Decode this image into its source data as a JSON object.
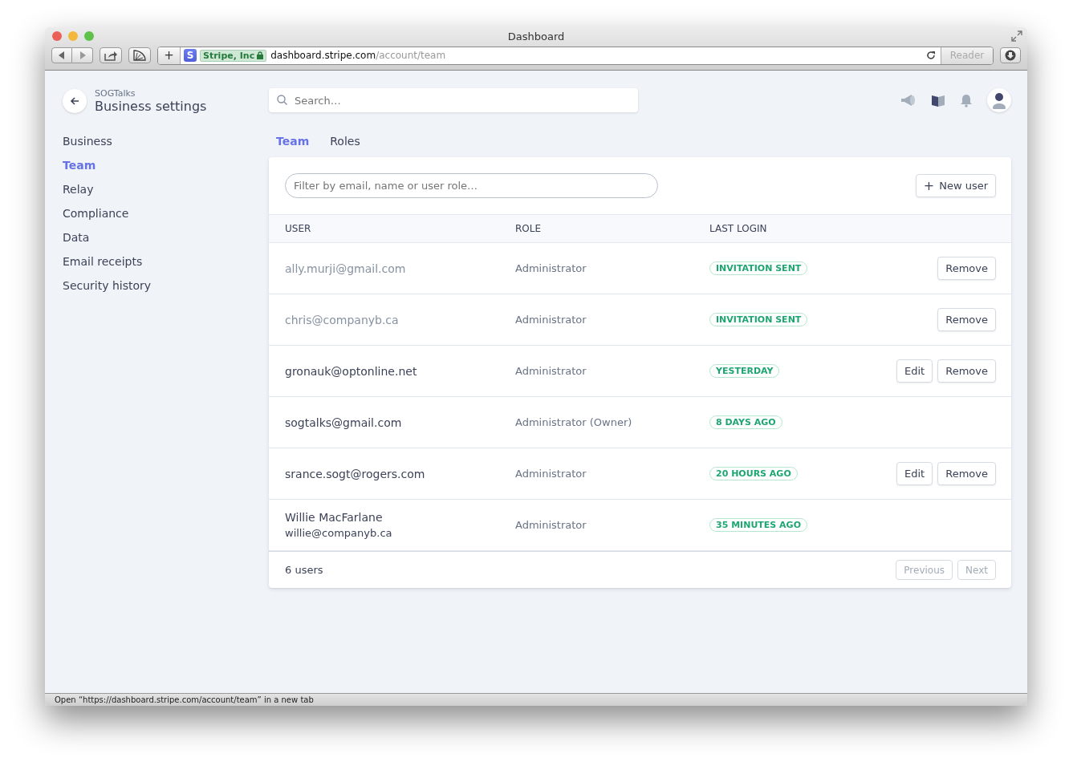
{
  "window": {
    "title": "Dashboard"
  },
  "toolbar": {
    "site_logo": "S",
    "site_badge": "Stripe, Inc",
    "url_host": "dashboard.stripe.com",
    "url_path": "/account/team",
    "reader_button": "Reader",
    "reader_disabled": true
  },
  "header": {
    "account": "SOGTalks",
    "title": "Business settings"
  },
  "search": {
    "placeholder": "Search…"
  },
  "sidebar": {
    "items": [
      {
        "label": "Business",
        "selected": false
      },
      {
        "label": "Team",
        "selected": true
      },
      {
        "label": "Relay",
        "selected": false
      },
      {
        "label": "Compliance",
        "selected": false
      },
      {
        "label": "Data",
        "selected": false
      },
      {
        "label": "Email receipts",
        "selected": false
      },
      {
        "label": "Security history",
        "selected": false
      }
    ]
  },
  "tabs": [
    {
      "label": "Team",
      "selected": true
    },
    {
      "label": "Roles",
      "selected": false
    }
  ],
  "filter": {
    "placeholder": "Filter by email, name or user role…"
  },
  "new_user_button": {
    "icon": "+",
    "label": "New user"
  },
  "table": {
    "columns": [
      "USER",
      "ROLE",
      "LAST LOGIN"
    ],
    "rows": [
      {
        "name": "ally.murji@gmail.com",
        "pending": true,
        "role": "Administrator",
        "last_login": "INVITATION SENT",
        "actions": [
          "Remove"
        ]
      },
      {
        "name": "chris@companyb.ca",
        "pending": true,
        "role": "Administrator",
        "last_login": "INVITATION SENT",
        "actions": [
          "Remove"
        ]
      },
      {
        "name": "gronauk@optonline.net",
        "pending": false,
        "role": "Administrator",
        "last_login": "YESTERDAY",
        "actions": [
          "Edit",
          "Remove"
        ]
      },
      {
        "name": "sogtalks@gmail.com",
        "pending": false,
        "role": "Administrator (Owner)",
        "last_login": "8 DAYS AGO",
        "actions": []
      },
      {
        "name": "srance.sogt@rogers.com",
        "pending": false,
        "role": "Administrator",
        "last_login": "20 HOURS AGO",
        "actions": [
          "Edit",
          "Remove"
        ]
      },
      {
        "name": "Willie MacFarlane",
        "email": "willie@companyb.ca",
        "pending": false,
        "role": "Administrator",
        "last_login": "35 MINUTES AGO",
        "actions": []
      }
    ]
  },
  "footer": {
    "count": "6 users",
    "buttons": [
      {
        "label": "Previous",
        "disabled": true
      },
      {
        "label": "Next",
        "disabled": true
      }
    ]
  },
  "status_bar": "Open “https://dashboard.stripe.com/account/team” in a new tab"
}
